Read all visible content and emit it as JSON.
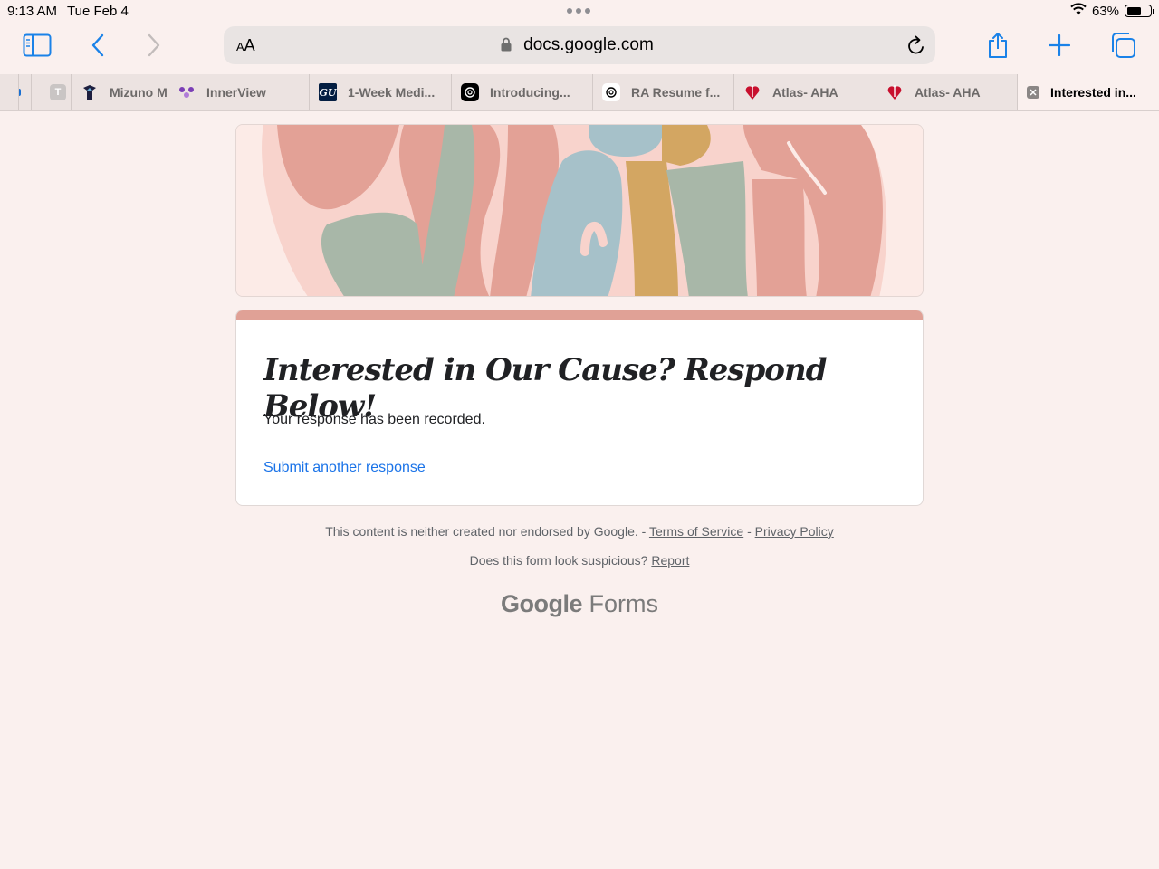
{
  "status": {
    "time": "9:13 AM",
    "date": "Tue Feb 4",
    "battery": "63%",
    "battery_level": 0.63
  },
  "toolbar": {
    "text_size": "AA",
    "url": "docs.google.com"
  },
  "tabs": [
    {
      "label": "",
      "icon": "partial-favicon"
    },
    {
      "label": "",
      "icon": "t-favicon"
    },
    {
      "label": "Mizuno M",
      "icon": "mizuno-favicon"
    },
    {
      "label": "InnerView",
      "icon": "innerview-favicon"
    },
    {
      "label": "1-Week Medi...",
      "icon": "gu-favicon"
    },
    {
      "label": "Introducing...",
      "icon": "openai-favicon"
    },
    {
      "label": "RA Resume f...",
      "icon": "openai-favicon"
    },
    {
      "label": "Atlas- AHA",
      "icon": "aha-heart-favicon"
    },
    {
      "label": "Atlas- AHA",
      "icon": "aha-heart-favicon"
    },
    {
      "label": "Interested in...",
      "icon": "close-icon",
      "active": true
    }
  ],
  "form": {
    "title": "Interested in Our Cause? Respond Below!",
    "confirmation": "Your response has been recorded.",
    "submit_another": "Submit another response"
  },
  "footer": {
    "disclaimer": "This content is neither created nor endorsed by Google. - ",
    "terms": "Terms of Service",
    "sep": " - ",
    "privacy": "Privacy Policy",
    "suspicious": "Does this form look suspicious? ",
    "report": "Report",
    "brand_google": "Google",
    "brand_forms": "Forms"
  },
  "colors": {
    "accent": "#e0a196",
    "link": "#1a73e8",
    "ios_blue": "#1a82e8",
    "background": "#faf0ee"
  }
}
